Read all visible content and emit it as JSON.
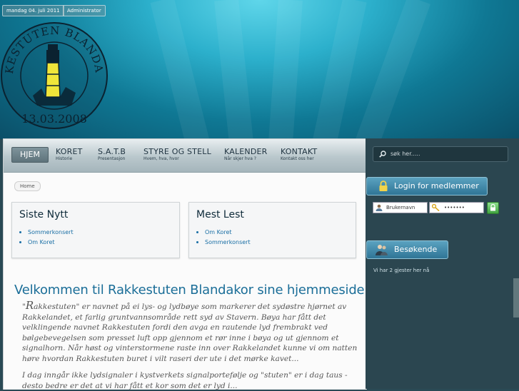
{
  "header": {
    "date": "mandag 04. juli 2011",
    "admin_link": "Administrator",
    "logo": {
      "arc_text": "RAKKESTUTEN BLANDAKOR",
      "date_text": "13.03.2008"
    }
  },
  "nav": {
    "items": [
      {
        "label": "HJEM",
        "sub": ""
      },
      {
        "label": "KORET",
        "sub": "Historie"
      },
      {
        "label": "S.A.T.B",
        "sub": "Presentasjon"
      },
      {
        "label": "STYRE OG STELL",
        "sub": "Hvem, hva, hvor"
      },
      {
        "label": "KALENDER",
        "sub": "Når skjer hva ?"
      },
      {
        "label": "KONTAKT",
        "sub": "Kontakt oss her"
      }
    ]
  },
  "breadcrumb": "Home",
  "boxes": [
    {
      "title": "Siste Nytt",
      "links": [
        "Sommerkonsert",
        "Om Koret"
      ]
    },
    {
      "title": "Mest Lest",
      "links": [
        "Om Koret",
        "Sommerkonsert"
      ]
    }
  ],
  "content": {
    "welcome": "Velkommen til Rakkestuten Blandakor sine hjemmesider.",
    "quote_open": "\"",
    "quote_initial": "R",
    "quote_rest": "akkestuten\" er navnet på ei lys- og lydbøye som markerer det sydøstre hjørnet av Rakkelandet, et farlig gruntvannsområde rett syd av Stavern. Bøya har fått det velklingende navnet Rakkestuten fordi den avga en rautende lyd frembrakt ved bølgebevegelsen som presset luft opp gjennom et rør inne i bøya og ut gjennom et signalhorn. Når høst og vinterstormene raste inn over Rakkelandet kunne vi om natten høre hvordan Rakkestuten buret i vilt raseri der ute i det mørke kavet...",
    "paragraph2": "I dag inngår ikke lydsignaler i kystverkets signalportefølje og \"stuten\" er i dag taus - desto bedre er det at vi har fått et kor som det er lyd i..."
  },
  "sidebar": {
    "search_placeholder": "søk her.....",
    "login_title": "Login for medlemmer",
    "username_placeholder": "Brukernavn",
    "password_placeholder": "•••••••",
    "visitors_title": "Besøkende",
    "visitors_text": "Vi har 2 gjester her nå"
  },
  "colors": {
    "accent": "#1b6e98",
    "sidebar_bg": "#2b4650",
    "tab_blue": "#2f7596",
    "login_green": "#5cc15c"
  }
}
